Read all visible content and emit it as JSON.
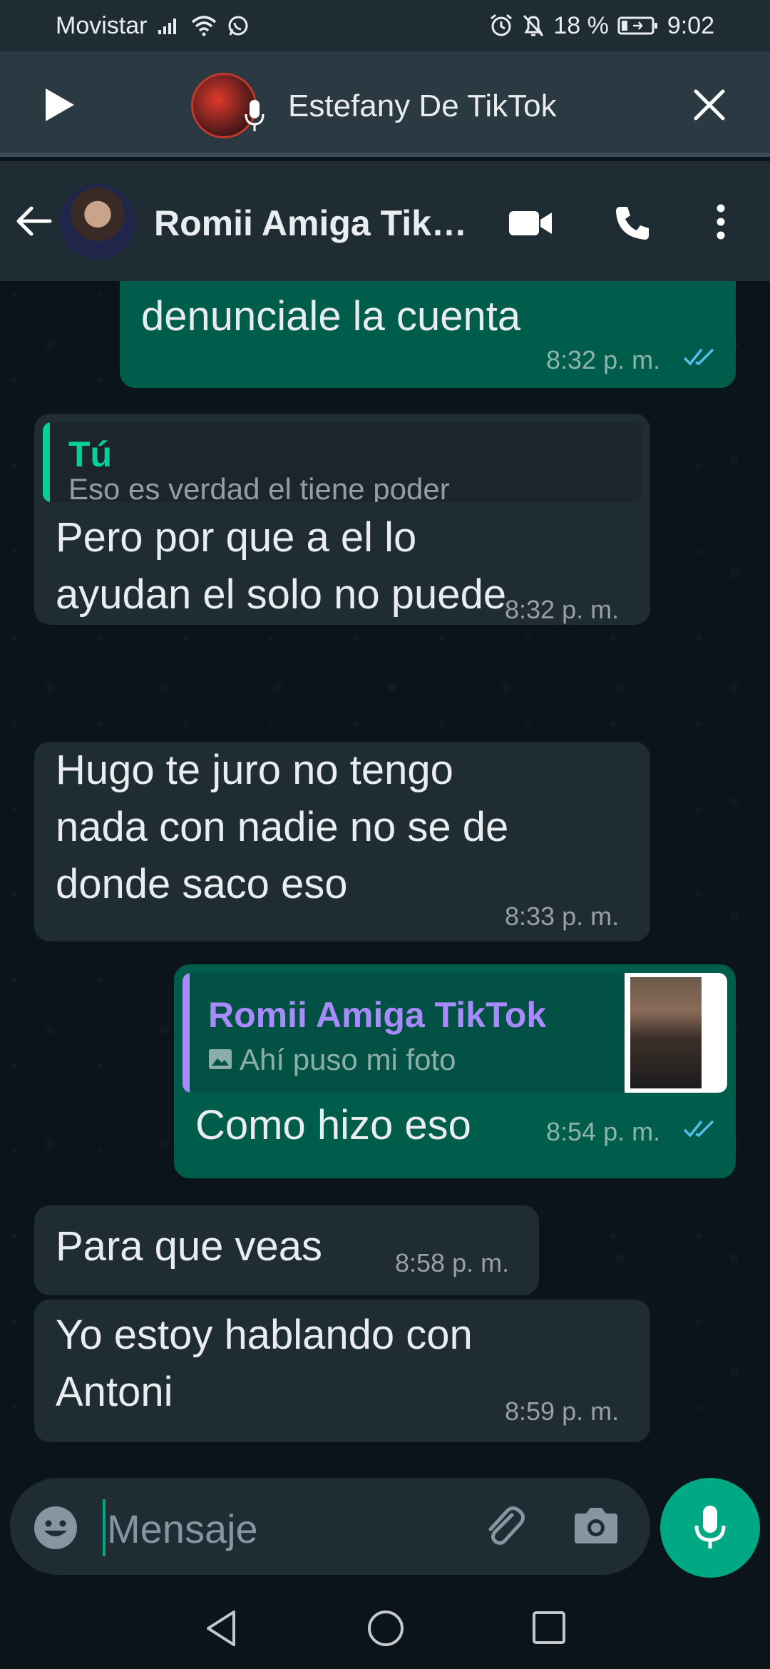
{
  "status_bar": {
    "carrier": "Movistar",
    "battery": "18 %",
    "time": "9:02"
  },
  "audio_bar": {
    "title": "Estefany De TikTok"
  },
  "header": {
    "contact_name": "Romii Amiga Tik…"
  },
  "messages": [
    {
      "direction": "out",
      "text": "denunciale la cuenta",
      "time": "8:32 p. m.",
      "read": true
    },
    {
      "direction": "in",
      "quote_author": "Tú",
      "quote_text": "Eso es verdad el tiene poder",
      "text_lines": [
        "Pero por que a el lo",
        "ayudan el solo no puede"
      ],
      "time": "8:32 p. m."
    },
    {
      "direction": "in",
      "text_lines": [
        "Hugo te juro no tengo",
        "nada con nadie no se de",
        "donde saco eso"
      ],
      "time": "8:33 p. m."
    },
    {
      "direction": "out",
      "quote_author": "Romii Amiga TikTok",
      "quote_text": "Ahí puso mi foto",
      "text": "Como hizo eso",
      "time": "8:54 p. m.",
      "read": true
    },
    {
      "direction": "in",
      "text": "Para que veas",
      "time": "8:58 p. m."
    },
    {
      "direction": "in",
      "text_lines": [
        "Yo estoy hablando con",
        "Antoni"
      ],
      "time": "8:59 p. m."
    }
  ],
  "composer": {
    "placeholder": "Mensaje"
  },
  "colors": {
    "accent": "#00a884",
    "outgoing_bubble": "#005c4b",
    "incoming_bubble": "#202c33",
    "read_ticks": "#53bdeb",
    "quote_self": "#06cf9c",
    "quote_contact": "#a78bfa"
  }
}
